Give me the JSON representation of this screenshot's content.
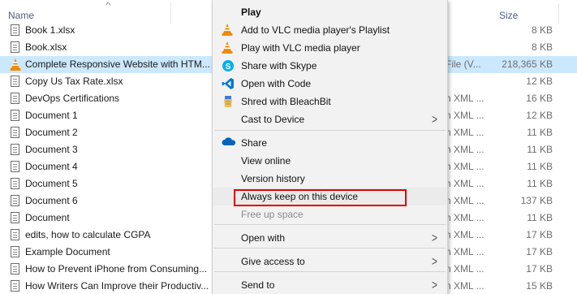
{
  "header": {
    "name_label": "Name",
    "size_label": "Size"
  },
  "files": [
    {
      "name": "Book 1.xlsx",
      "type": "",
      "size": "8 KB",
      "icon": "document-icon",
      "selected": false
    },
    {
      "name": "Book.xlsx",
      "type": "",
      "size": "8 KB",
      "icon": "document-icon",
      "selected": false
    },
    {
      "name": "Complete Responsive Website with HTM...",
      "type": "File (V...",
      "size": "218,365 KB",
      "icon": "vlc-icon",
      "selected": true
    },
    {
      "name": "Copy Us Tax Rate.xlsx",
      "type": "",
      "size": "12 KB",
      "icon": "document-icon",
      "selected": false
    },
    {
      "name": "DevOps Certifications",
      "type": "n XML ...",
      "size": "16 KB",
      "icon": "document-icon",
      "selected": false
    },
    {
      "name": "Document 1",
      "type": "n XML ...",
      "size": "12 KB",
      "icon": "document-icon",
      "selected": false
    },
    {
      "name": "Document 2",
      "type": "n XML ...",
      "size": "11 KB",
      "icon": "document-icon",
      "selected": false
    },
    {
      "name": "Document 3",
      "type": "n XML ...",
      "size": "11 KB",
      "icon": "document-icon",
      "selected": false
    },
    {
      "name": "Document 4",
      "type": "n XML ...",
      "size": "11 KB",
      "icon": "document-icon",
      "selected": false
    },
    {
      "name": "Document 5",
      "type": "n XML ...",
      "size": "11 KB",
      "icon": "document-icon",
      "selected": false
    },
    {
      "name": "Document 6",
      "type": "n XML ...",
      "size": "137 KB",
      "icon": "document-icon",
      "selected": false
    },
    {
      "name": "Document",
      "type": "n XML ...",
      "size": "11 KB",
      "icon": "document-icon",
      "selected": false
    },
    {
      "name": "edits, how to calculate CGPA",
      "type": "n XML ...",
      "size": "17 KB",
      "icon": "document-icon",
      "selected": false
    },
    {
      "name": "Example Document",
      "type": "n XML ...",
      "size": "17 KB",
      "icon": "document-icon",
      "selected": false
    },
    {
      "name": "How to Prevent iPhone from Consuming...",
      "type": "n XML ...",
      "size": "17 KB",
      "icon": "document-icon",
      "selected": false
    },
    {
      "name": "How Writers Can Improve their Productiv...",
      "type": "n XML ...",
      "size": "15 KB",
      "icon": "document-icon",
      "selected": false
    }
  ],
  "context_menu": {
    "items": [
      {
        "label": "Play",
        "icon": "none",
        "bold": true,
        "submenu": false,
        "disabled": false
      },
      {
        "label": "Add to VLC media player's Playlist",
        "icon": "vlc-icon",
        "bold": false,
        "submenu": false,
        "disabled": false
      },
      {
        "label": "Play with VLC media player",
        "icon": "vlc-icon",
        "bold": false,
        "submenu": false,
        "disabled": false
      },
      {
        "label": "Share with Skype",
        "icon": "skype-icon",
        "bold": false,
        "submenu": false,
        "disabled": false
      },
      {
        "label": "Open with Code",
        "icon": "vscode-icon",
        "bold": false,
        "submenu": false,
        "disabled": false
      },
      {
        "label": "Shred with BleachBit",
        "icon": "bleachbit-icon",
        "bold": false,
        "submenu": false,
        "disabled": false
      },
      {
        "label": "Cast to Device",
        "icon": "none",
        "bold": false,
        "submenu": true,
        "disabled": false
      },
      {
        "label": "Share",
        "icon": "onedrive-icon",
        "bold": false,
        "submenu": false,
        "disabled": false
      },
      {
        "label": "View online",
        "icon": "none",
        "bold": false,
        "submenu": false,
        "disabled": false
      },
      {
        "label": "Version history",
        "icon": "none",
        "bold": false,
        "submenu": false,
        "disabled": false
      },
      {
        "label": "Always keep on this device",
        "icon": "none",
        "bold": false,
        "submenu": false,
        "disabled": false,
        "highlighted": true
      },
      {
        "label": "Free up space",
        "icon": "none",
        "bold": false,
        "submenu": false,
        "disabled": true
      },
      {
        "label": "Open with",
        "icon": "none",
        "bold": false,
        "submenu": true,
        "disabled": false
      },
      {
        "label": "Give access to",
        "icon": "none",
        "bold": false,
        "submenu": true,
        "disabled": false
      },
      {
        "label": "Send to",
        "icon": "none",
        "bold": false,
        "submenu": true,
        "disabled": false
      }
    ]
  },
  "colors": {
    "selection": "#cce8ff",
    "menu_bg": "#f2f2f2",
    "highlight_box": "#e00000",
    "vlc_orange": "#f08a00",
    "skype_blue": "#00aff0",
    "vscode_blue": "#0078d4",
    "onedrive_blue": "#0364b8"
  }
}
